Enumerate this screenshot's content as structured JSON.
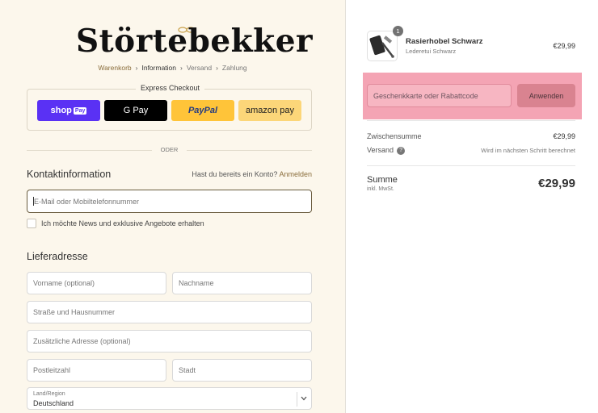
{
  "brand": {
    "logo_text": "Störtebekker"
  },
  "breadcrumbs": [
    {
      "label": "Warenkorb"
    },
    {
      "label": "Information"
    },
    {
      "label": "Versand"
    },
    {
      "label": "Zahlung"
    }
  ],
  "express": {
    "title": "Express Checkout",
    "shop_pay": "shop",
    "shop_pay_badge": "Pay",
    "gpay": "G Pay",
    "paypal": "PayPal",
    "amazon": "amazon pay"
  },
  "divider_text": "ODER",
  "contact": {
    "heading": "Kontaktinformation",
    "account_prompt": "Hast du bereits ein Konto?",
    "login_link": "Anmelden",
    "email_placeholder": "E-Mail oder Mobiltelefonnummer",
    "newsletter_label": "Ich möchte News und exklusive Angebote erhalten"
  },
  "shipping": {
    "heading": "Lieferadresse",
    "first_name": "Vorname (optional)",
    "last_name": "Nachname",
    "street": "Straße und Hausnummer",
    "address2": "Zusätzliche Adresse (optional)",
    "postal": "Postleitzahl",
    "city": "Stadt",
    "country_label": "Land/Region",
    "country_value": "Deutschland"
  },
  "summary": {
    "product": {
      "name": "Rasierhobel Schwarz",
      "variant": "Lederetui Schwarz",
      "price": "€29,99",
      "quantity": "1"
    },
    "discount_placeholder": "Geschenkkarte oder Rabattcode",
    "apply_label": "Anwenden",
    "subtotal_label": "Zwischensumme",
    "subtotal_value": "€29,99",
    "shipping_label": "Versand",
    "shipping_value": "Wird im nächsten Schritt berechnet",
    "total_label": "Summe",
    "tax_note": "inkl. MwSt.",
    "total_value": "€29,99"
  },
  "colors": {
    "accent": "#8a6d3b",
    "highlight": "#f4a4b4",
    "shop_pay": "#5a31f4",
    "paypal": "#ffc439",
    "amazon": "#fcd679"
  }
}
